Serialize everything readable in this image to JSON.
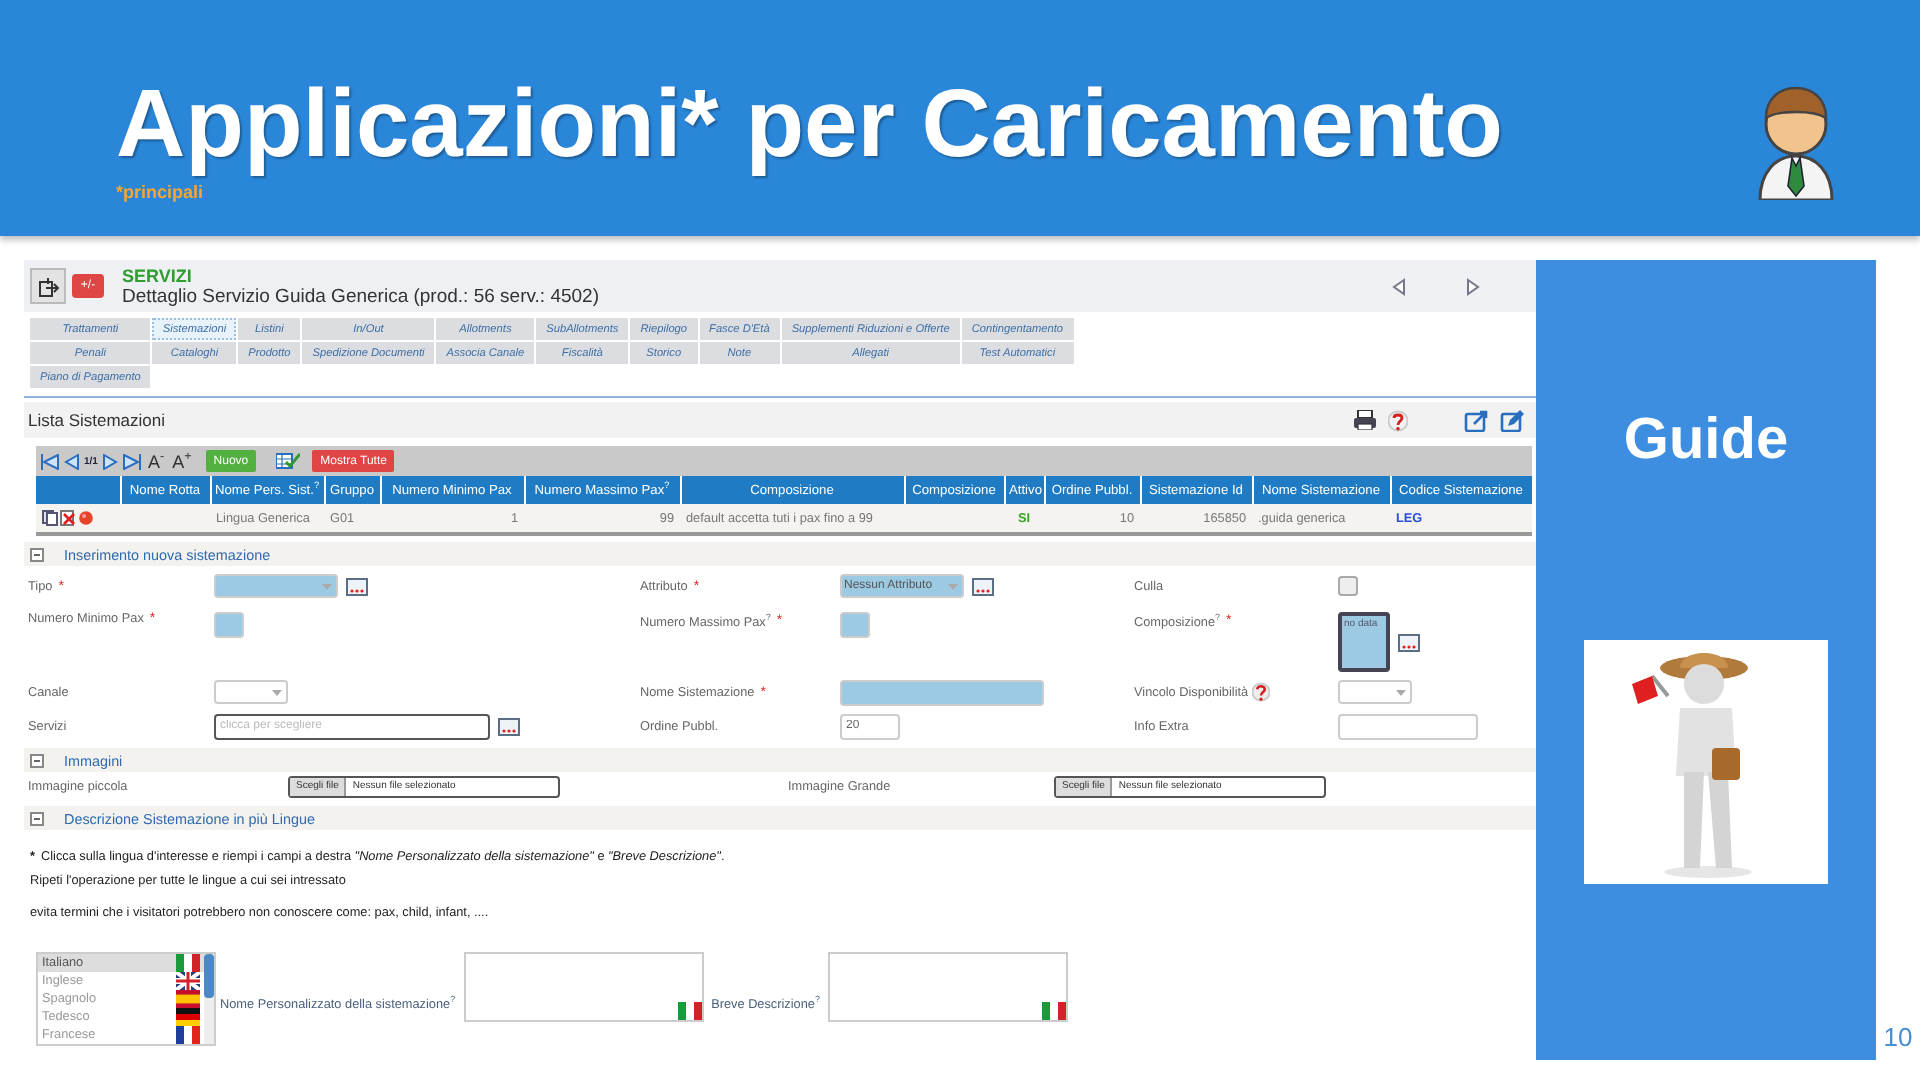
{
  "slide": {
    "title": "Applicazioni* per Caricamento",
    "subtitle": "*principali",
    "page_number": "10"
  },
  "app": {
    "section": "SERVIZI",
    "toggle_label": "+/-",
    "detail": "Dettaglio Servizio Guida Generica (prod.: 56 serv.: 4502)",
    "tab_rows": [
      {
        "tabs": [
          {
            "label": "Trattamenti",
            "selected": false
          },
          {
            "label": "Sistemazioni",
            "selected": true
          },
          {
            "label": "Listini",
            "selected": false
          },
          {
            "label": "In/Out",
            "selected": false
          },
          {
            "label": "Allotments",
            "selected": false
          },
          {
            "label": "SubAllotments",
            "selected": false
          },
          {
            "label": "Riepilogo",
            "selected": false
          },
          {
            "label": "Fasce D'Età",
            "selected": false
          },
          {
            "label": "Supplementi Riduzioni e Offerte",
            "selected": false
          },
          {
            "label": "Contingentamento",
            "selected": false
          }
        ]
      },
      {
        "tabs": [
          {
            "label": "Penali",
            "selected": false
          },
          {
            "label": "Cataloghi",
            "selected": false
          },
          {
            "label": "Prodotto",
            "selected": false
          },
          {
            "label": "Spedizione Documenti",
            "selected": false
          },
          {
            "label": "Associa Canale",
            "selected": false
          },
          {
            "label": "Fiscalità",
            "selected": false
          },
          {
            "label": "Storico",
            "selected": false
          },
          {
            "label": "Note",
            "selected": false
          },
          {
            "label": "Allegati",
            "selected": false
          },
          {
            "label": "Test Automatici",
            "selected": false
          }
        ]
      },
      {
        "tabs": [
          {
            "label": "Piano di Pagamento",
            "selected": false
          }
        ]
      }
    ],
    "list_title": "Lista Sistemazioni",
    "toolbar": {
      "page": "1/1",
      "font_buttons": [
        "A$^{-}$",
        "A$^{+}$"
      ],
      "buttons": [
        {
          "label": "Nuovo",
          "kind": "new"
        },
        {
          "label": "Mostra Tutte",
          "kind": "show"
        }
      ]
    },
    "table": {
      "columns": [
        {
          "kind": "actions"
        },
        {
          "label": "Nome Rotta",
          "kind": "text"
        },
        {
          "label": "Nome Pers. Sist.$^{?}$",
          "kind": "text"
        },
        {
          "label": "Gruppo",
          "kind": "text"
        },
        {
          "label": "Numero Minimo Pax",
          "kind": "number"
        },
        {
          "label": "Numero Massimo Pax$^{?}$",
          "kind": "number"
        },
        {
          "label": "Composizione",
          "kind": "text"
        },
        {
          "label": "Composizione",
          "kind": "text"
        },
        {
          "label": "Attivo",
          "kind": "status"
        },
        {
          "label": "Ordine Pubbl.",
          "kind": "number"
        },
        {
          "label": "Sistemazione Id",
          "kind": "number"
        },
        {
          "label": "Nome Sistemazione",
          "kind": "text"
        },
        {
          "label": "Codice Sistemazione",
          "kind": "code"
        }
      ],
      "rows": [
        {
          "cells": [
            null,
            null,
            "Lingua Generica",
            "G01",
            "1",
            "99",
            "default accetta tuti i pax fino a 99",
            null,
            "SI",
            "10",
            "165850",
            ".guida generica",
            "LEG"
          ]
        }
      ]
    },
    "form": {
      "section": {
        "title": "Inserimento nuova sistemazione",
        "expanded": true
      },
      "fields": [
        {
          "label": "Tipo",
          "required_mark": "*",
          "kind": "select",
          "highlighted": true,
          "picker": true
        },
        {
          "label": "Attributo",
          "required_mark": "*",
          "kind": "select",
          "highlighted": true,
          "value": "Nessun Attributo",
          "picker": true
        },
        {
          "label": "Culla",
          "kind": "checkbox",
          "checked": false
        },
        {
          "label": "Numero Minimo Pax",
          "required_mark": "*",
          "kind": "number",
          "highlighted": true
        },
        {
          "label": "Numero Massimo Pax$^{?}$",
          "required_mark": "*",
          "kind": "number",
          "highlighted": true
        },
        {
          "label": "Composizione$^{?}$",
          "required_mark": "*",
          "kind": "listbox",
          "highlighted": true,
          "value": "no data",
          "picker": true
        },
        {
          "label": "Canale",
          "kind": "select",
          "highlighted": false
        },
        {
          "label": "Nome Sistemazione",
          "required_mark": "*",
          "kind": "text",
          "highlighted": true
        },
        {
          "label": "Vincolo Disponibilità",
          "help_icon": true,
          "kind": "select",
          "highlighted": false
        },
        {
          "label": "Servizi",
          "kind": "text",
          "highlighted": false,
          "placeholder": "clicca per scegliere",
          "picker": true
        },
        {
          "label": "Ordine Pubbl.",
          "kind": "text",
          "highlighted": false,
          "value": "20"
        },
        {
          "label": "Info Extra",
          "kind": "text",
          "highlighted": false
        }
      ]
    },
    "images": {
      "section": {
        "title": "Immagini",
        "expanded": true
      },
      "fields": [
        {
          "label": "Immagine piccola",
          "button": "Scegli file",
          "status": "Nessun file selezionato"
        },
        {
          "label": "Immagine Grande",
          "button": "Scegli file",
          "status": "Nessun file selezionato"
        }
      ]
    },
    "descriptions": {
      "section": {
        "title": "Descrizione Sistemazione in più Lingue",
        "expanded": true
      },
      "notes": [
        {
          "mark": "*",
          "text": "Clicca sulla lingua d'interesse e riempi i campi a destra *\"Nome Personalizzato della sistemazione\"* e *\"Breve Descrizione\"*."
        },
        {
          "text": "Ripeti l'operazione per tutte le lingue a cui sei intressato"
        },
        {
          "text": "evita termini che i visitatori potrebbero non conoscere come: pax, child, infant, ...."
        }
      ],
      "languages": [
        {
          "label": "Italiano",
          "kind": "italy",
          "selected": true
        },
        {
          "label": "Inglese",
          "kind": "uk",
          "selected": false
        },
        {
          "label": "Spagnolo",
          "kind": "spain",
          "selected": false
        },
        {
          "label": "Tedesco",
          "kind": "germany",
          "selected": false
        },
        {
          "label": "Francese",
          "kind": "france",
          "selected": false
        }
      ],
      "fields": [
        {
          "label": "Nome Personalizzato della sistemazione$^{?}$",
          "kind": "italy"
        },
        {
          "label": "Breve Descrizione$^{?}$",
          "kind": "italy"
        }
      ]
    }
  },
  "side_panel": {
    "heading": "Guide"
  }
}
